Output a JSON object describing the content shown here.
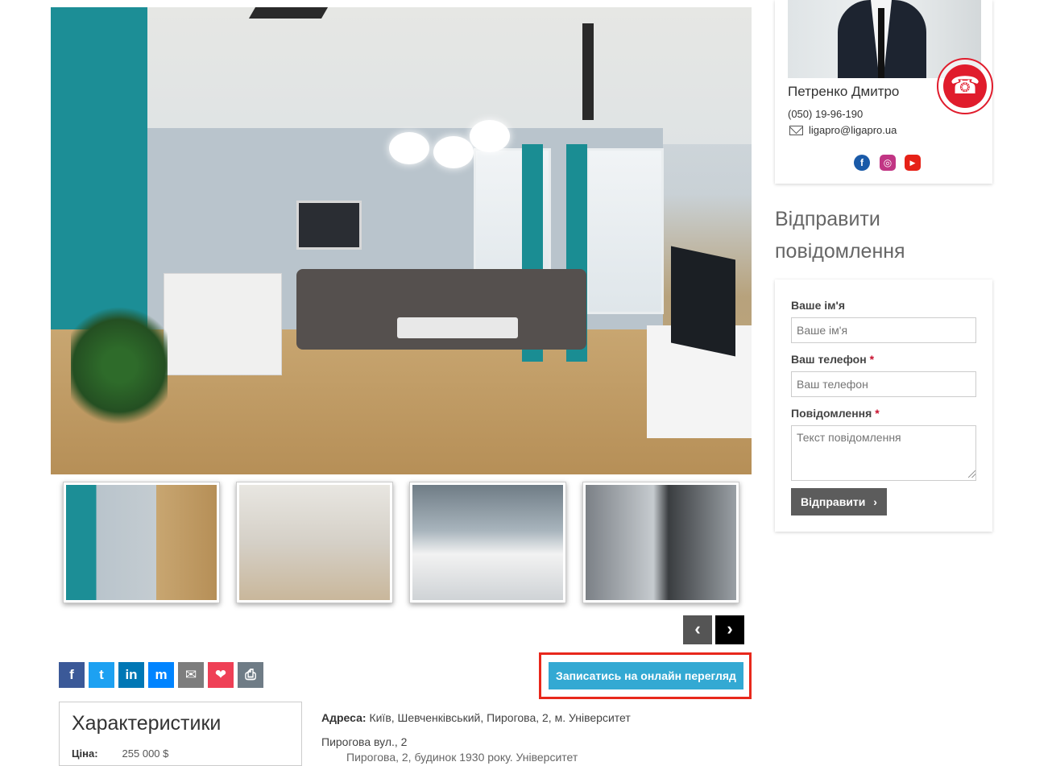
{
  "gallery": {
    "thumbnails": [
      "living-room",
      "kitchen-dining",
      "kitchen",
      "built-in-appliances"
    ],
    "prev_icon": "‹",
    "next_icon": "›"
  },
  "share": {
    "buttons": [
      {
        "name": "facebook",
        "glyph": "f",
        "color": "#3b5998"
      },
      {
        "name": "twitter",
        "glyph": "t",
        "color": "#1da1f2"
      },
      {
        "name": "linkedin",
        "glyph": "in",
        "color": "#0077b5"
      },
      {
        "name": "messenger",
        "glyph": "m",
        "color": "#0084ff"
      },
      {
        "name": "email",
        "glyph": "✉",
        "color": "#7d7d7d"
      },
      {
        "name": "pocket",
        "glyph": "❤",
        "color": "#ef4056"
      },
      {
        "name": "print",
        "glyph": "⎙",
        "color": "#6f7c86"
      }
    ]
  },
  "online_view_button": "Записатись на онлайн перегляд",
  "characteristics": {
    "title": "Характеристики",
    "price_label": "Ціна:",
    "price_value": "255 000 $"
  },
  "address": {
    "label": "Адреса:",
    "value": "Київ, Шевченківський, Пирогова, 2, м. Університет",
    "street": "Пирогова вул., 2",
    "description_partial": "Пирогова, 2, будинок 1930 року. Університет"
  },
  "agent": {
    "name": "Петренко Дмитро",
    "phone": "(050) 19-96-190",
    "email": "ligapro@ligapro.ua",
    "socials": [
      {
        "name": "facebook",
        "glyph": "f",
        "color": "#1a5aa8"
      },
      {
        "name": "instagram",
        "glyph": "◎",
        "color": "#c13584"
      },
      {
        "name": "youtube",
        "glyph": "▶",
        "color": "#e62117"
      }
    ]
  },
  "call_button_icon": "☎",
  "form": {
    "heading": "Відправити повідомлення",
    "name_label": "Ваше ім'я",
    "name_placeholder": "Ваше ім'я",
    "phone_label": "Ваш телефон",
    "phone_placeholder": "Ваш телефон",
    "message_label": "Повідомлення",
    "message_placeholder": "Текст повідомлення",
    "required_mark": "*",
    "submit_label": "Відправити",
    "submit_icon": "›"
  },
  "colors": {
    "accent_button": "#33a9d3",
    "highlight_border": "#e8281c",
    "call_red": "#e01c2c",
    "submit_gray": "#5c5c5c"
  }
}
